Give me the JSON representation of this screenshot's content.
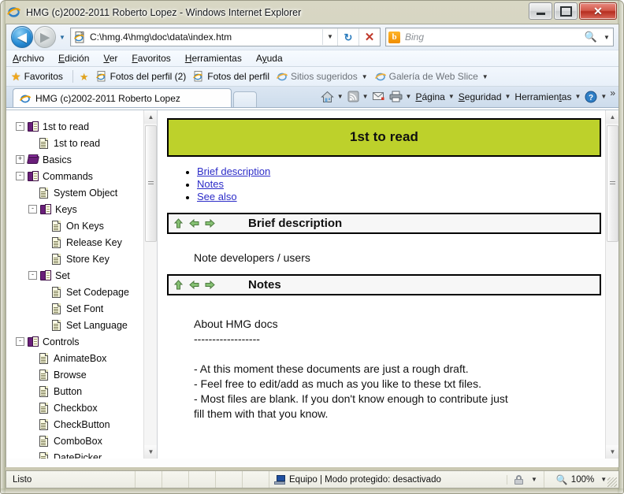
{
  "window": {
    "title": "HMG (c)2002-2011 Roberto Lopez - Windows Internet Explorer",
    "minimize_label": "Minimizar",
    "maximize_label": "Maximizar",
    "close_label": "Cerrar"
  },
  "nav": {
    "back_label": "Atrás",
    "forward_label": "Adelante",
    "history_label": "Páginas recientes",
    "address_value": "C:\\hmg.4\\hmg\\doc\\data\\index.htm",
    "address_placeholder": "",
    "refresh_label": "Actualizar",
    "stop_label": "Detener",
    "search_placeholder": "Bing",
    "search_value": "",
    "search_provider": "Bing",
    "search_provider_glyph": "b"
  },
  "menubar": {
    "items": [
      {
        "pre": "",
        "hot": "A",
        "post": "rchivo"
      },
      {
        "pre": "",
        "hot": "E",
        "post": "dición"
      },
      {
        "pre": "",
        "hot": "V",
        "post": "er"
      },
      {
        "pre": "",
        "hot": "F",
        "post": "avoritos"
      },
      {
        "pre": "",
        "hot": "H",
        "post": "erramientas"
      },
      {
        "pre": "A",
        "hot": "y",
        "post": "uda"
      }
    ]
  },
  "favbar": {
    "favorites_label": "Favoritos",
    "add_label": "Agregar a Favoritos",
    "items": [
      {
        "label": "Fotos del perfil (2)",
        "icon": "ie-page-icon",
        "dim": false,
        "caret": false
      },
      {
        "label": "Fotos del perfil",
        "icon": "ie-page-icon",
        "dim": false,
        "caret": false
      },
      {
        "label": "Sitios sugeridos",
        "icon": "ie-logo-icon",
        "dim": true,
        "caret": true
      },
      {
        "label": "Galería de Web Slice",
        "icon": "ie-logo-icon",
        "dim": true,
        "caret": true
      }
    ]
  },
  "tabs": {
    "active_tab_label": "HMG (c)2002-2011 Roberto Lopez",
    "new_tab_label": ""
  },
  "commandbar": {
    "home_label": "Página principal",
    "feeds_label": "Fuentes",
    "mail_label": "Leer correo",
    "print_label": "Imprimir",
    "items": [
      {
        "pre": "",
        "hot": "P",
        "post": "ágina"
      },
      {
        "pre": "",
        "hot": "S",
        "post": "eguridad"
      },
      {
        "pre": "Herramien",
        "hot": "t",
        "post": "as"
      }
    ],
    "help_label": "Ayuda",
    "overflow_label": "»"
  },
  "tree": {
    "nodes": [
      {
        "indent": 0,
        "toggle": "-",
        "icon": "open-book-icon",
        "label": "1st to read"
      },
      {
        "indent": 1,
        "toggle": "",
        "icon": "document-icon",
        "label": "1st to read"
      },
      {
        "indent": 0,
        "toggle": "+",
        "icon": "closed-book-icon",
        "label": "Basics"
      },
      {
        "indent": 0,
        "toggle": "-",
        "icon": "open-book-icon",
        "label": "Commands"
      },
      {
        "indent": 1,
        "toggle": "",
        "icon": "document-icon",
        "label": "System Object"
      },
      {
        "indent": 1,
        "toggle": "-",
        "icon": "open-book-icon",
        "label": "Keys"
      },
      {
        "indent": 2,
        "toggle": "",
        "icon": "document-icon",
        "label": "On Keys"
      },
      {
        "indent": 2,
        "toggle": "",
        "icon": "document-icon",
        "label": "Release Key"
      },
      {
        "indent": 2,
        "toggle": "",
        "icon": "document-icon",
        "label": "Store Key"
      },
      {
        "indent": 1,
        "toggle": "-",
        "icon": "open-book-icon",
        "label": "Set"
      },
      {
        "indent": 2,
        "toggle": "",
        "icon": "document-icon",
        "label": "Set Codepage"
      },
      {
        "indent": 2,
        "toggle": "",
        "icon": "document-icon",
        "label": "Set Font"
      },
      {
        "indent": 2,
        "toggle": "",
        "icon": "document-icon",
        "label": "Set Language"
      },
      {
        "indent": 0,
        "toggle": "-",
        "icon": "open-book-icon",
        "label": "Controls"
      },
      {
        "indent": 1,
        "toggle": "",
        "icon": "document-icon",
        "label": "AnimateBox"
      },
      {
        "indent": 1,
        "toggle": "",
        "icon": "document-icon",
        "label": "Browse"
      },
      {
        "indent": 1,
        "toggle": "",
        "icon": "document-icon",
        "label": "Button"
      },
      {
        "indent": 1,
        "toggle": "",
        "icon": "document-icon",
        "label": "Checkbox"
      },
      {
        "indent": 1,
        "toggle": "",
        "icon": "document-icon",
        "label": "CheckButton"
      },
      {
        "indent": 1,
        "toggle": "",
        "icon": "document-icon",
        "label": "ComboBox"
      },
      {
        "indent": 1,
        "toggle": "",
        "icon": "document-icon",
        "label": "DatePicker"
      }
    ]
  },
  "content": {
    "page_title": "1st to read",
    "toc": [
      {
        "label": "Brief description"
      },
      {
        "label": "Notes"
      },
      {
        "label": "See also"
      }
    ],
    "sections": [
      {
        "heading": "Brief description",
        "body": "Note developers / users",
        "nav_icons": [
          "arrow-up-icon",
          "arrow-left-icon",
          "arrow-right-icon"
        ]
      },
      {
        "heading": "Notes",
        "body": "",
        "nav_icons": [
          "arrow-up-icon",
          "arrow-left-icon",
          "arrow-right-icon"
        ]
      }
    ],
    "notes_text": [
      "About HMG docs",
      "------------------",
      "",
      "- At this moment these documents are just a rough draft.",
      "- Feel free to edit/add as much as you like to these txt files.",
      "- Most files are blank. If you don't know enough to contribute just",
      "fill them with that you know."
    ]
  },
  "statusbar": {
    "status_text": "Listo",
    "zone_text": "Equipo | Modo protegido: desactivado",
    "zoom_level": "100%"
  },
  "colors": {
    "banner_green": "#bdd12b",
    "link_blue": "#2c2cc8",
    "arrow_green": "#79b46a",
    "tree_icon_purple": "#6a1f7a"
  }
}
